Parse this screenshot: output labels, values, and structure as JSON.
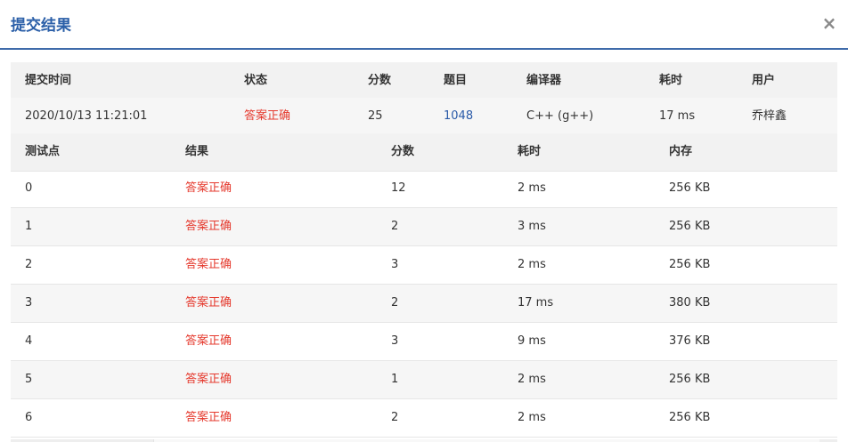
{
  "modal": {
    "title": "提交结果",
    "close_glyph": "×"
  },
  "summary": {
    "headers": {
      "submit_time": "提交时间",
      "status": "状态",
      "score": "分数",
      "problem": "题目",
      "compiler": "编译器",
      "time": "耗时",
      "user": "用户"
    },
    "row": {
      "submit_time": "2020/10/13 11:21:01",
      "status": "答案正确",
      "score": "25",
      "problem": "1048",
      "compiler": "C++ (g++)",
      "time": "17 ms",
      "user": "乔梓鑫"
    }
  },
  "testcases": {
    "headers": {
      "case": "测试点",
      "result": "结果",
      "score": "分数",
      "time": "耗时",
      "memory": "内存"
    },
    "rows": [
      {
        "case": "0",
        "result": "答案正确",
        "score": "12",
        "time": "2 ms",
        "memory": "256 KB"
      },
      {
        "case": "1",
        "result": "答案正确",
        "score": "2",
        "time": "3 ms",
        "memory": "256 KB"
      },
      {
        "case": "2",
        "result": "答案正确",
        "score": "3",
        "time": "2 ms",
        "memory": "256 KB"
      },
      {
        "case": "3",
        "result": "答案正确",
        "score": "2",
        "time": "17 ms",
        "memory": "380 KB"
      },
      {
        "case": "4",
        "result": "答案正确",
        "score": "3",
        "time": "9 ms",
        "memory": "376 KB"
      },
      {
        "case": "5",
        "result": "答案正确",
        "score": "1",
        "time": "2 ms",
        "memory": "256 KB"
      },
      {
        "case": "6",
        "result": "答案正确",
        "score": "2",
        "time": "2 ms",
        "memory": "256 KB"
      }
    ]
  },
  "colors": {
    "accent": "#2b5fa8",
    "status_ok": "#e53a2e",
    "header_bg": "#f2f2f2"
  }
}
